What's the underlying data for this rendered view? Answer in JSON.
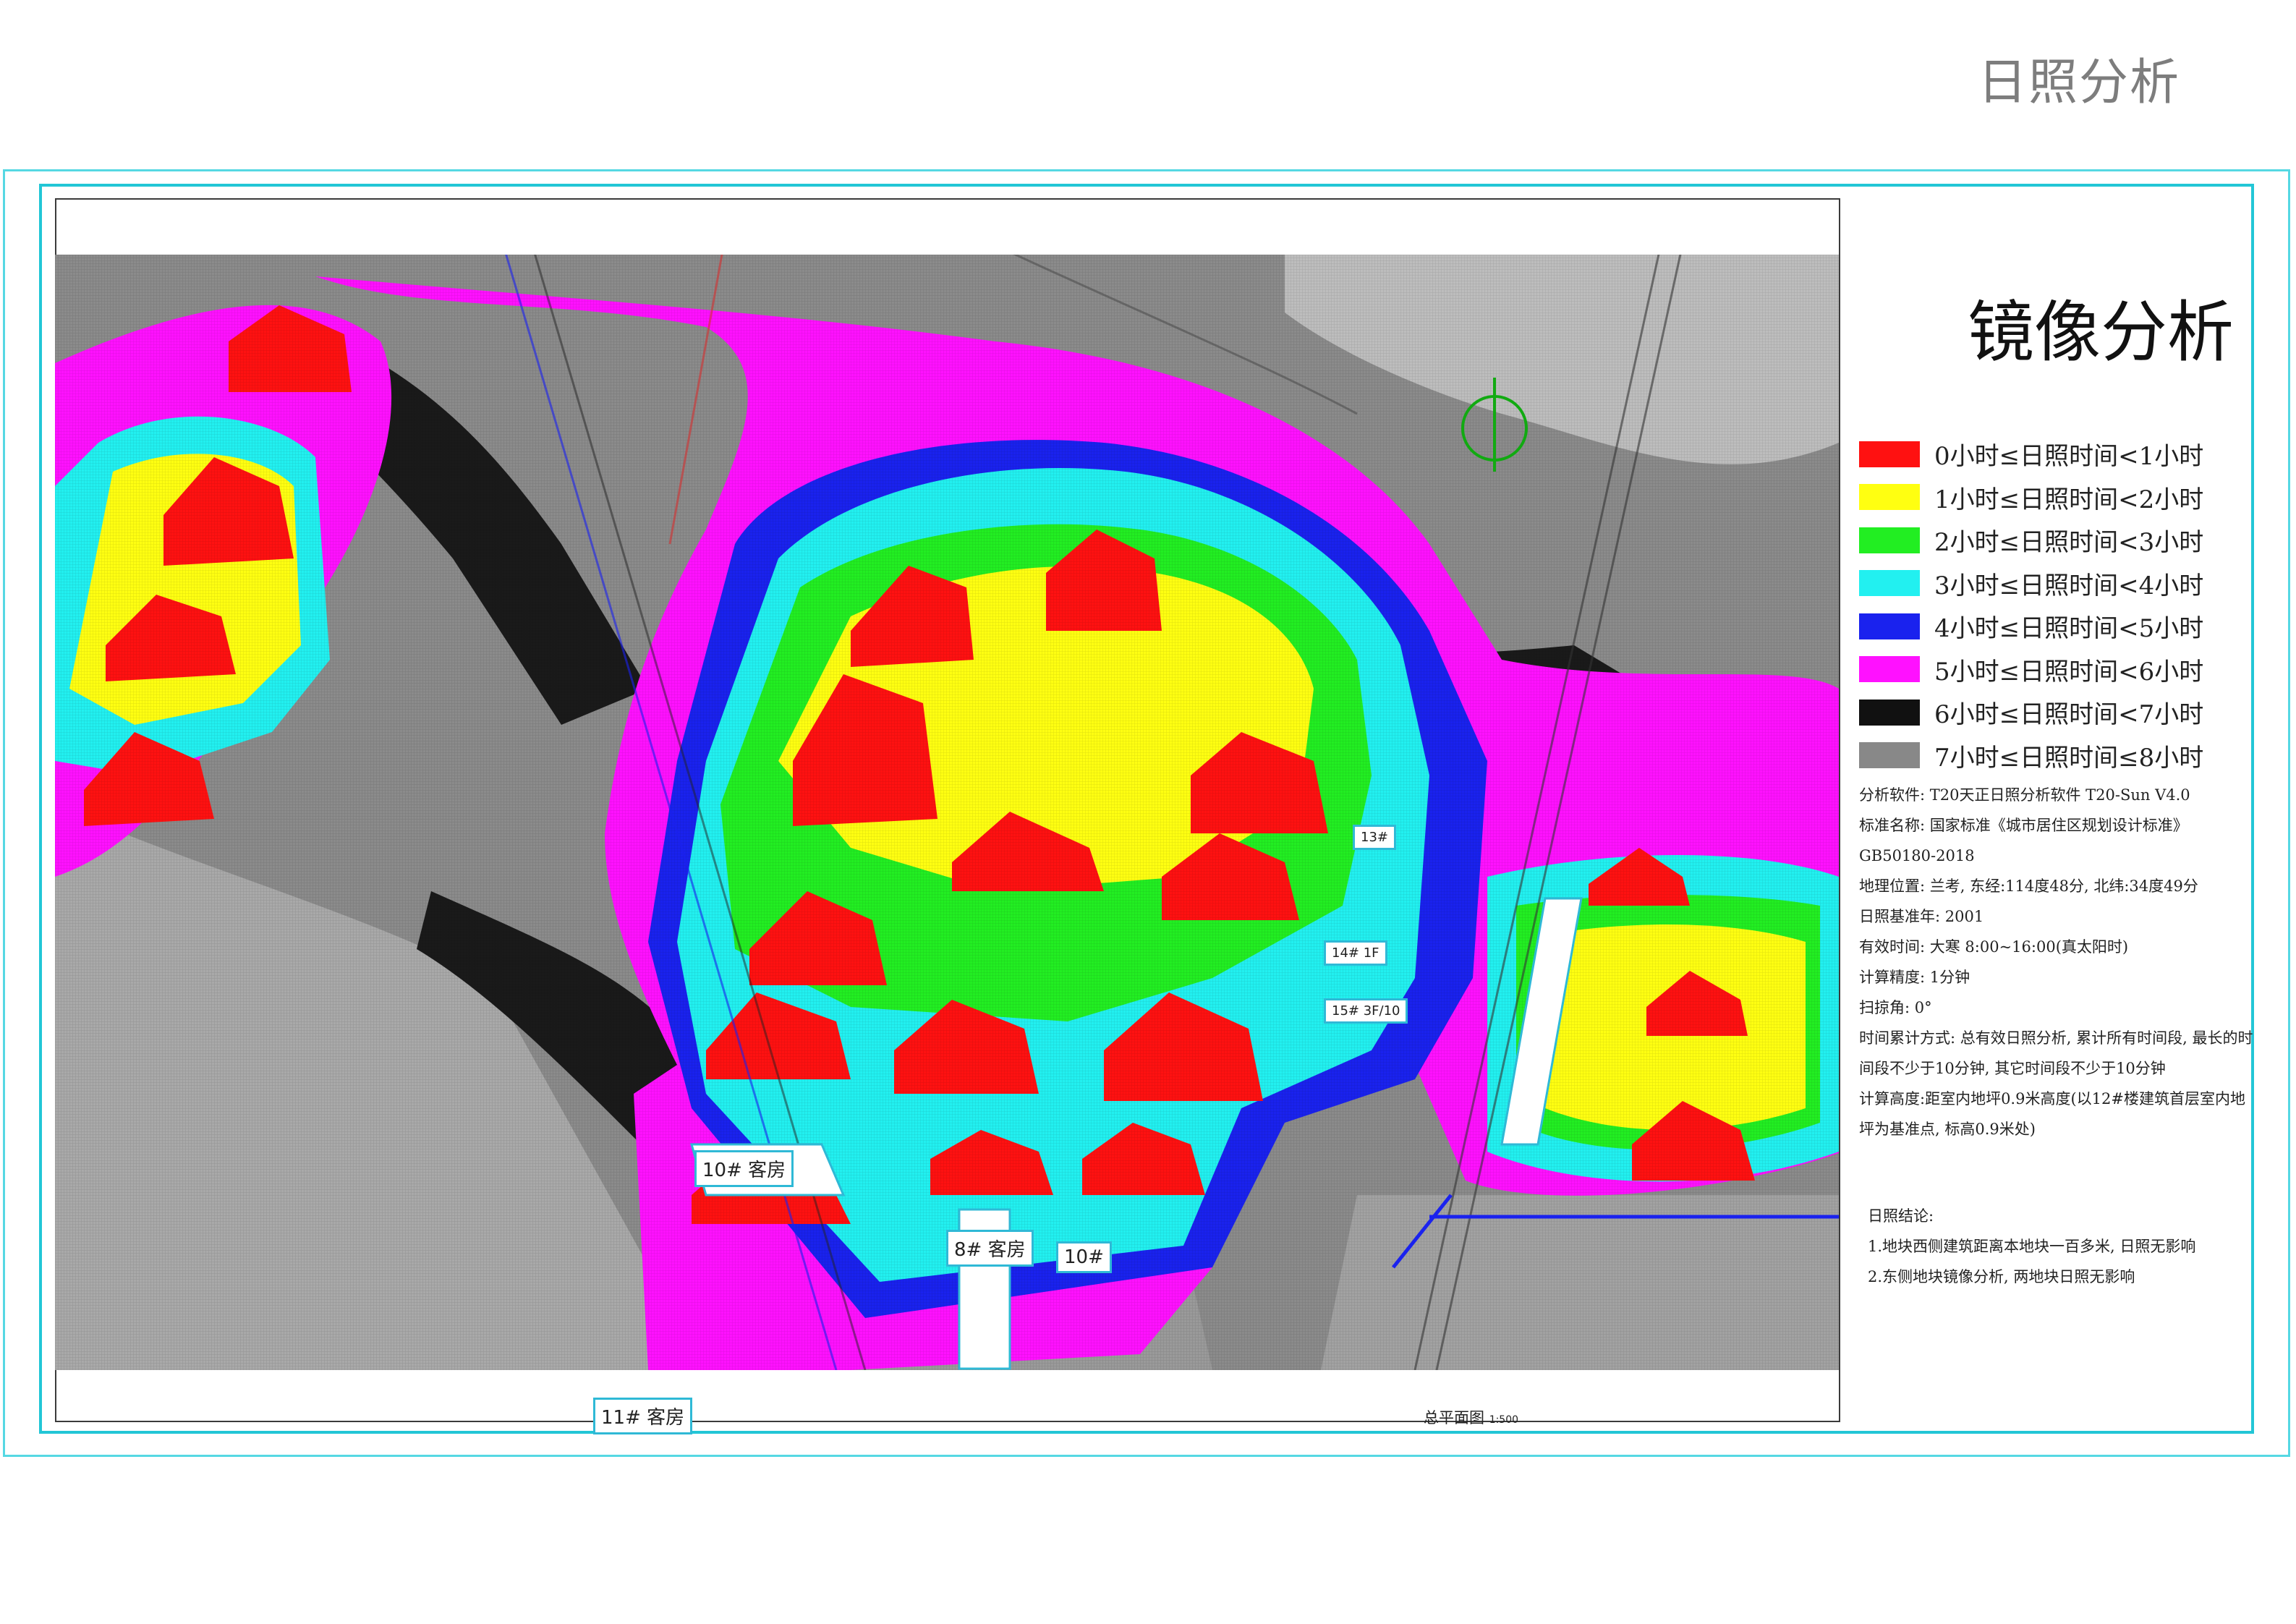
{
  "page_title": "日照分析",
  "mirror_title": "镜像分析",
  "legend": [
    {
      "color": "#ff1111",
      "label": "0小时≤日照时间<1小时"
    },
    {
      "color": "#ffff11",
      "label": "1小时≤日照时间<2小时"
    },
    {
      "color": "#22ee22",
      "label": "2小时≤日照时间<3小时"
    },
    {
      "color": "#22f0f0",
      "label": "3小时≤日照时间<4小时"
    },
    {
      "color": "#1a22ee",
      "label": "4小时≤日照时间<5小时"
    },
    {
      "color": "#ff11ff",
      "label": "5小时≤日照时间<6小时"
    },
    {
      "color": "#111111",
      "label": "6小时≤日照时间<7小时"
    },
    {
      "color": "#888888",
      "label": "7小时≤日照时间≤8小时"
    }
  ],
  "info": {
    "software": "分析软件: T20天正日照分析软件 T20-Sun V4.0",
    "standard": "标准名称: 国家标准《城市居住区规划设计标准》",
    "standard_code": "GB50180-2018",
    "location": "地理位置: 兰考, 东经:114度48分, 北纬:34度49分",
    "base_year": "日照基准年: 2001",
    "valid_time": "有效时间: 大寒 8:00~16:00(真太阳时)",
    "precision": "计算精度: 1分钟",
    "scan_angle": "扫掠角: 0°",
    "accumulation": "时间累计方式: 总有效日照分析, 累计所有时间段, 最长的时间段不少于10分钟, 其它时间段不少于10分钟",
    "calc_height": "计算高度:距室内地坪0.9米高度(以12#楼建筑首层室内地坪为基准点, 标高0.9米处)"
  },
  "conclusion": {
    "title": "日照结论:",
    "items": [
      "1.地块西侧建筑距离本地块一百多米, 日照无影响",
      "2.东侧地块镜像分析, 两地块日照无影响"
    ]
  },
  "plan_caption": {
    "label": "总平面图",
    "scale": "1:500"
  },
  "building_labels": {
    "b10": "10# 客房",
    "b8": "8# 客房",
    "b10b": "10#",
    "b11": "11# 客房",
    "b13": "13#",
    "b14": "14# 1F",
    "b15": "15# 3F/10"
  }
}
